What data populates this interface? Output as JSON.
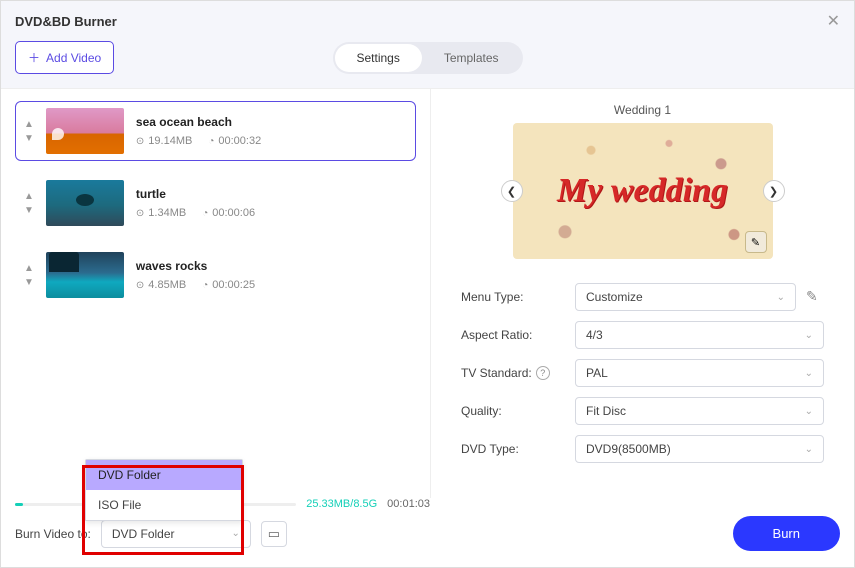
{
  "window": {
    "title": "DVD&BD Burner"
  },
  "header": {
    "add_video": "Add Video",
    "tab_settings": "Settings",
    "tab_templates": "Templates"
  },
  "videos": [
    {
      "title": "sea ocean beach",
      "size": "19.14MB",
      "duration": "00:00:32"
    },
    {
      "title": "turtle",
      "size": "1.34MB",
      "duration": "00:00:06"
    },
    {
      "title": "waves rocks",
      "size": "4.85MB",
      "duration": "00:00:25"
    }
  ],
  "preview": {
    "title": "Wedding 1",
    "caption": "My wedding"
  },
  "settings": {
    "menu_type": {
      "label": "Menu Type:",
      "value": "Customize"
    },
    "aspect_ratio": {
      "label": "Aspect Ratio:",
      "value": "4/3"
    },
    "tv_standard": {
      "label": "TV Standard:",
      "value": "PAL"
    },
    "quality": {
      "label": "Quality:",
      "value": "Fit Disc"
    },
    "dvd_type": {
      "label": "DVD Type:",
      "value": "DVD9(8500MB)"
    }
  },
  "footer": {
    "progress_text": "25.33MB/8.5G",
    "progress_time": "00:01:03",
    "burn_to_label": "Burn Video to:",
    "burn_to_value": "DVD Folder",
    "dropdown_options": [
      "DVD Folder",
      "ISO File"
    ],
    "burn_button": "Burn"
  }
}
